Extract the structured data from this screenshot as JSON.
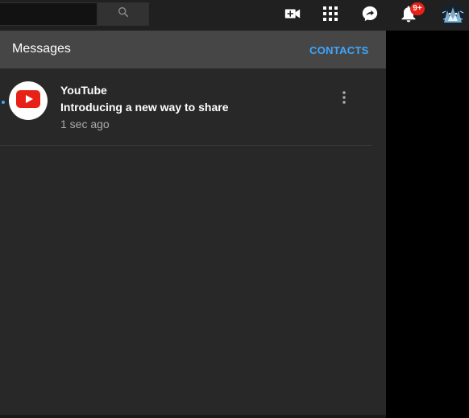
{
  "masthead": {
    "search": {
      "value": "",
      "placeholder": ""
    },
    "icons": {
      "search": "search-icon",
      "create": "video-camera-plus-icon",
      "apps": "apps-grid-icon",
      "messages": "messages-share-icon",
      "notifications": "bell-icon"
    },
    "notification_badge": "9+"
  },
  "messages_panel": {
    "title": "Messages",
    "contacts_label": "CONTACTS",
    "items": [
      {
        "sender": "YouTube",
        "text": "Introducing a new way to share",
        "time": "1 sec ago",
        "unread": true
      }
    ]
  },
  "colors": {
    "masthead_bg": "#202020",
    "panel_bg": "#282828",
    "panel_header_bg": "#464646",
    "accent_blue": "#3ea6ff",
    "badge_red": "#e62117",
    "youtube_red": "#e62117"
  }
}
